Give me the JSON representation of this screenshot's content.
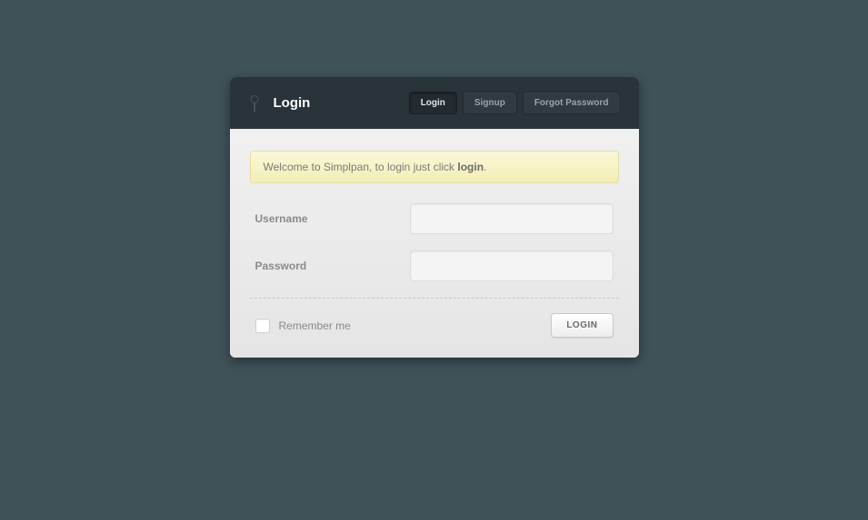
{
  "header": {
    "title": "Login",
    "tabs": {
      "login": "Login",
      "signup": "Signup",
      "forgot": "Forgot Password"
    }
  },
  "notice": {
    "prefix": "Welcome to Simplpan, to login just click ",
    "strong": "login",
    "suffix": "."
  },
  "form": {
    "username_label": "Username",
    "username_value": "",
    "password_label": "Password",
    "password_value": "",
    "remember_label": "Remember me",
    "submit_label": "LOGIN"
  }
}
